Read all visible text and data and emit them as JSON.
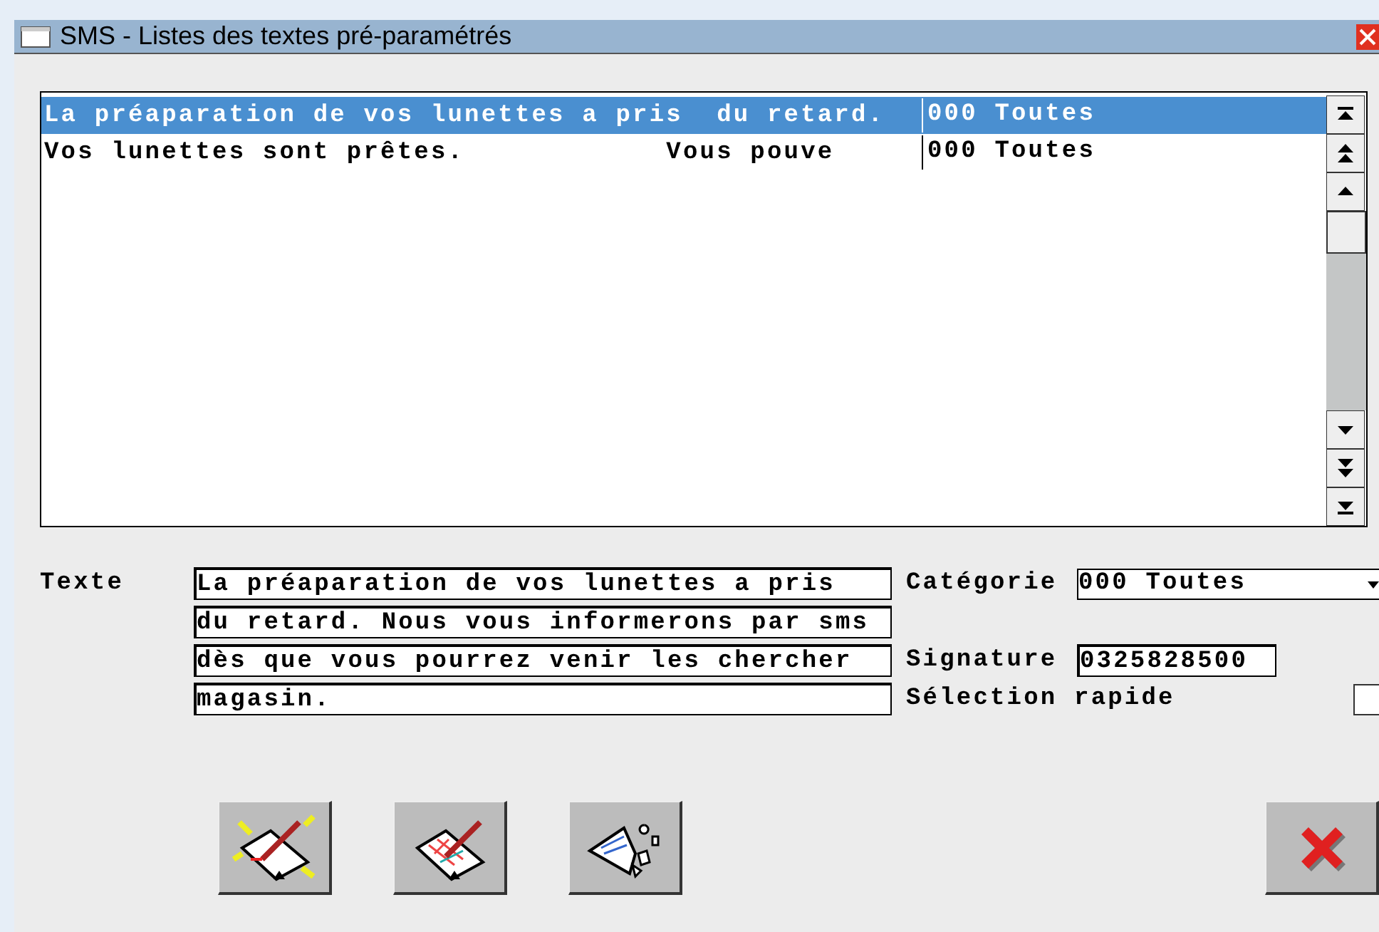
{
  "window": {
    "title": "SMS - Listes des textes pré-paramétrés"
  },
  "list": {
    "rows": [
      {
        "text": "La préaparation de vos lunettes a pris  du retard.",
        "category": "000 Toutes",
        "selected": true
      },
      {
        "text": "Vos lunettes sont prêtes.            Vous pouve",
        "category": "000 Toutes",
        "selected": false
      }
    ]
  },
  "form": {
    "texte_label": "Texte",
    "texte_lines": [
      "La préaparation de vos lunettes a pris",
      "du retard. Nous vous informerons par sms",
      "dès que vous pourrez venir les chercher",
      "magasin."
    ],
    "categorie_label": "Catégorie",
    "categorie_value": "000 Toutes",
    "signature_label": "Signature",
    "signature_value": "0325828500",
    "selection_label": "Sélection rapide",
    "selection_checked": false
  },
  "buttons": [
    {
      "kind": "new"
    },
    {
      "kind": "edit"
    },
    {
      "kind": "delete"
    },
    {
      "kind": "close"
    }
  ]
}
